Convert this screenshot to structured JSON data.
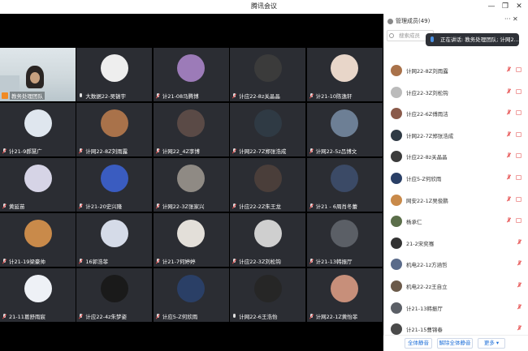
{
  "window": {
    "title": "腾讯会议",
    "min_glyph": "—",
    "restore_glyph": "❐",
    "close_glyph": "✕"
  },
  "tiles": [
    {
      "name": "教务处理团队",
      "color": "#d9d2c7",
      "self": true,
      "mic": "on"
    },
    {
      "name": "大数据22-吴镐宇",
      "color": "#eeeeee",
      "mic": "on"
    },
    {
      "name": "计21-08马腾博",
      "color": "#9c7bb8",
      "mic": "off"
    },
    {
      "name": "计应22-8z关晶晶",
      "color": "#3b3b3b",
      "mic": "off"
    },
    {
      "name": "计21-10陈逸轩",
      "color": "#e8d6c9",
      "mic": "off"
    },
    {
      "name": "计21-9郝慧广",
      "color": "#dfe6ee",
      "mic": "off"
    },
    {
      "name": "计网22-8Z刘雨露",
      "color": "#a9724a",
      "mic": "off"
    },
    {
      "name": "计网22_4Z李博",
      "color": "#5a4a46",
      "mic": "off"
    },
    {
      "name": "计网22-7Z郑张浩成",
      "color": "#2f3a44",
      "mic": "off"
    },
    {
      "name": "计网22-5z吕博文",
      "color": "#6d7f95",
      "mic": "off"
    },
    {
      "name": "黄延苗",
      "color": "#d6d4e6",
      "mic": "off"
    },
    {
      "name": "计21-20史兴隆",
      "color": "#3a5cc0",
      "mic": "off"
    },
    {
      "name": "计网22-3Z张家兴",
      "color": "#8f8a84",
      "mic": "off"
    },
    {
      "name": "计应22-2Z朱王龙",
      "color": "#4a3e3a",
      "mic": "off"
    },
    {
      "name": "计21 - 6周肖冬蕾",
      "color": "#3b4a66",
      "mic": "off"
    },
    {
      "name": "计21-19梁豪帅",
      "color": "#c98a4a",
      "mic": "off"
    },
    {
      "name": "16郭浩菲",
      "color": "#d5dbe8",
      "mic": "off"
    },
    {
      "name": "计21-7何婷婷",
      "color": "#e3dfd9",
      "mic": "off"
    },
    {
      "name": "计应22-3Z刘松钩",
      "color": "#cfcfcf",
      "mic": "off"
    },
    {
      "name": "计21-13韩振厅",
      "color": "#5b5f66",
      "mic": "off"
    },
    {
      "name": "21-11葛舒雨宸",
      "color": "#eef1f6",
      "mic": "off"
    },
    {
      "name": "计应22-4z朱梦姿",
      "color": "#1a1a1a",
      "mic": "off"
    },
    {
      "name": "计应5-Z何欣雨",
      "color": "#2a3f66",
      "mic": "off"
    },
    {
      "name": "计网22-6王浩怡",
      "color": "#262626",
      "mic": "on"
    },
    {
      "name": "计网22-1Z黄怡菲",
      "color": "#c78f7a",
      "mic": "off"
    }
  ],
  "panel": {
    "title": "管理成员(49)",
    "more": "···",
    "close": "✕",
    "search_placeholder": "搜索成员",
    "speaking_toast": "正在讲话: 教务处理团队; 计网2..."
  },
  "members": [
    {
      "name": "计网22-8Z刘雨露",
      "color": "#a9724a",
      "video": true
    },
    {
      "name": "计应22-3Z刘松钩",
      "color": "#bbbbbb",
      "video": true
    },
    {
      "name": "计应22-6Z傅雨洁",
      "color": "#8a5a4a",
      "video": true
    },
    {
      "name": "计网22-7Z郑张浩成",
      "color": "#2f3a44",
      "video": true
    },
    {
      "name": "计应22-8z关晶晶",
      "color": "#3b3b3b",
      "video": true
    },
    {
      "name": "计应5-Z何欣雨",
      "color": "#2a3f66",
      "video": true
    },
    {
      "name": "网安22-1Z吴俊鹏",
      "color": "#c98a4a",
      "video": true
    },
    {
      "name": "杨承仁",
      "color": "#5b6e4a",
      "video": true
    },
    {
      "name": "21-2宋奕骞",
      "color": "#333333",
      "video": false
    },
    {
      "name": "机电22-1z方涵哲",
      "color": "#5a6b8a",
      "video": false
    },
    {
      "name": "机电22-2z王自立",
      "color": "#6b5a4a",
      "video": false
    },
    {
      "name": "计21-13韩振厅",
      "color": "#5b5f66",
      "video": false
    },
    {
      "name": "计21-15曹锦春",
      "color": "#4a4a4a",
      "video": false
    }
  ],
  "footer": {
    "mute_all": "全体静音",
    "unmute_all": "解除全体静音",
    "more": "更多 ▾"
  }
}
